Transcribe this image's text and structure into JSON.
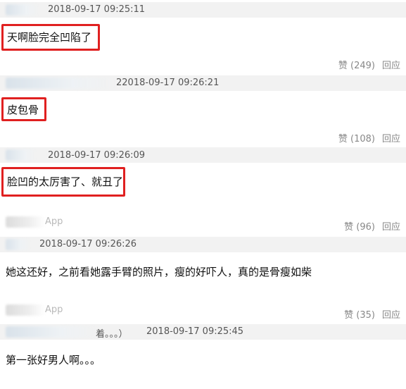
{
  "comments": [
    {
      "timestamp": "2018-09-17 09:25:11",
      "text": "天啊脸完全凹陷了",
      "like_label": "赞 (249)",
      "reply_label": "回应"
    },
    {
      "timestamp": "2018-09-17 09:26:21",
      "timestamp_prefix": "2",
      "text": "皮包骨",
      "like_label": "赞 (108)",
      "reply_label": "回应"
    },
    {
      "timestamp": "2018-09-17 09:26:09",
      "text": "脸凹的太厉害了、就丑了",
      "source": "App",
      "like_label": "赞 (96)",
      "reply_label": "回应"
    },
    {
      "timestamp": "2018-09-17 09:26:26",
      "text": "她这还好，之前看她露手臂的照片，瘦的好吓人，真的是骨瘦如柴",
      "source": "App",
      "like_label": "赞 (35)",
      "reply_label": "回应"
    },
    {
      "timestamp": "2018-09-17 09:25:45",
      "user_suffix": "着。。。）",
      "text": "第一张好男人啊。。。"
    }
  ]
}
